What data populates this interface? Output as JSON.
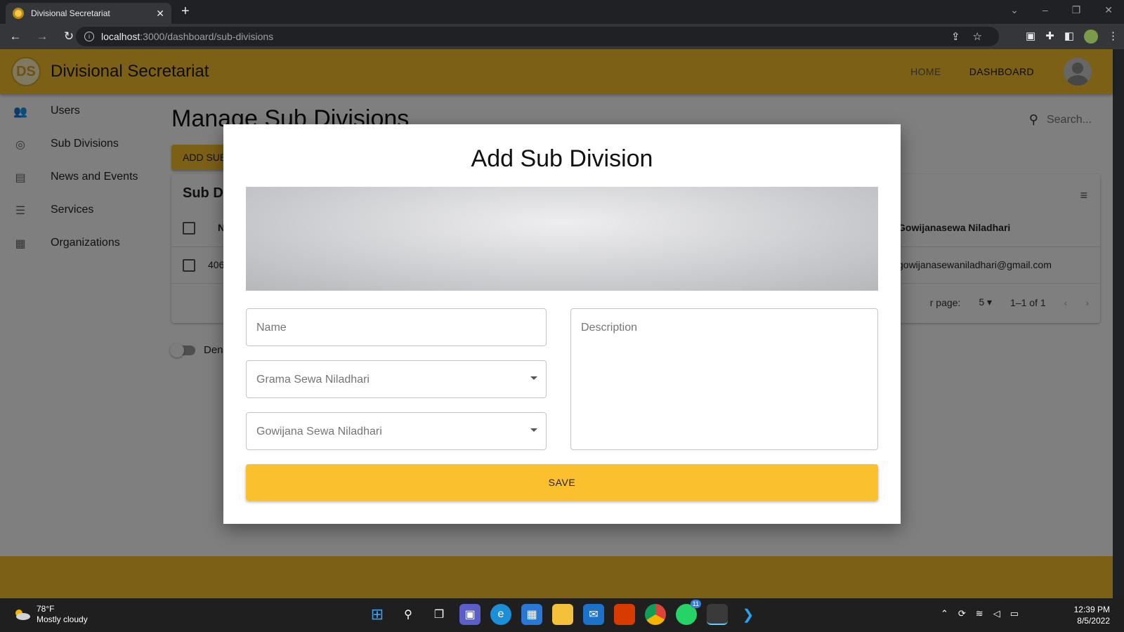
{
  "browser": {
    "tab_title": "Divisional Secretariat",
    "tab_close": "✕",
    "new_tab": "+",
    "url_host": "localhost",
    "url_path": ":3000/dashboard/sub-divisions"
  },
  "appbar": {
    "logo_text": "DS",
    "title": "Divisional Secretariat",
    "nav_home": "HOME",
    "nav_dashboard": "DASHBOARD"
  },
  "sidebar": {
    "items": [
      {
        "label": "Users",
        "icon": "users-icon"
      },
      {
        "label": "Sub Divisions",
        "icon": "location-icon"
      },
      {
        "label": "News and Events",
        "icon": "news-icon"
      },
      {
        "label": "Services",
        "icon": "services-icon"
      },
      {
        "label": "Organizations",
        "icon": "organizations-icon"
      }
    ]
  },
  "main": {
    "page_title": "Manage Sub Divisions",
    "search_placeholder": "Search...",
    "add_button": "ADD SUB",
    "table_title": "Sub Di",
    "header_col_first": "N",
    "header_col_gowijana": "Gowijanasewa Niladhari",
    "row_first": "406",
    "row_email": "gowijanasewaniladhari@gmail.com",
    "rows_per_page_label": "r page:",
    "rows_per_page_value": "5",
    "page_range": "1–1 of 1",
    "dense_label": "Den"
  },
  "modal": {
    "title": "Add Sub Division",
    "name_placeholder": "Name",
    "grama_placeholder": "Grama Sewa Niladhari",
    "gowijana_placeholder": "Gowijana Sewa Niladhari",
    "description_placeholder": "Description",
    "save_label": "SAVE"
  },
  "taskbar": {
    "temperature": "78°F",
    "weather": "Mostly cloudy",
    "time": "12:39 PM",
    "date": "8/5/2022",
    "whatsapp_badge": "11"
  },
  "colors": {
    "brand": "#f9c02d",
    "save": "#fbc02d"
  }
}
